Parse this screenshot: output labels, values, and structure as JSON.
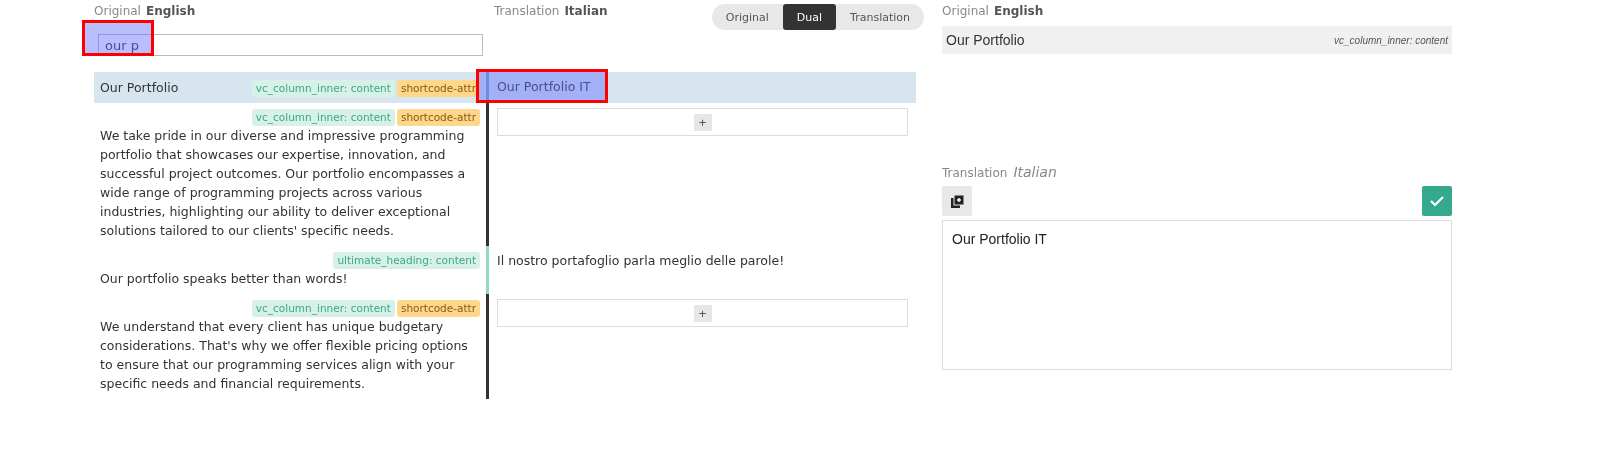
{
  "original_header": {
    "label": "Original",
    "language": "English"
  },
  "translation_header": {
    "label": "Translation",
    "language": "Italian"
  },
  "view_toggle": [
    {
      "label": "Original",
      "selected": false
    },
    {
      "label": "Dual",
      "selected": true
    },
    {
      "label": "Translation",
      "selected": false
    }
  ],
  "search": {
    "value": "our p",
    "highlighted": true
  },
  "rows": [
    {
      "text": "Our Portfolio",
      "tags": [
        {
          "label": "vc_column_inner: content",
          "kind": "context"
        },
        {
          "label": "shortcode-attr",
          "kind": "attr"
        }
      ],
      "selected": true,
      "translation": "Our Portfolio IT",
      "highlighted": true
    },
    {
      "text": "We take pride in our diverse and impressive programming portfolio that showcases our expertise, innovation, and successful project outcomes. Our portfolio encompasses a wide range of programming projects across various industries, highlighting our ability to deliver exceptional solutions tailored to our clients' specific needs.",
      "tags": [
        {
          "label": "vc_column_inner: content",
          "kind": "context"
        },
        {
          "label": "shortcode-attr",
          "kind": "attr"
        }
      ],
      "kind": "untranslated",
      "selected": false,
      "add_button": "+"
    },
    {
      "text": "Our portfolio speaks better than words!",
      "tags": [
        {
          "label": "ultimate_heading: content",
          "kind": "context"
        }
      ],
      "kind": "translated",
      "selected": false,
      "translation": "Il nostro portafoglio parla meglio delle parole!"
    },
    {
      "text": "We understand that every client has unique budgetary considerations. That's why we offer flexible pricing options to ensure that our programming services align with your specific needs and financial requirements.",
      "tags": [
        {
          "label": "vc_column_inner: content",
          "kind": "context"
        },
        {
          "label": "shortcode-attr",
          "kind": "attr"
        }
      ],
      "kind": "untranslated",
      "selected": false,
      "add_button": "+"
    }
  ],
  "editor": {
    "original_header": {
      "label": "Original",
      "language": "English"
    },
    "original_text": "Our Portfolio",
    "context": "vc_column_inner: content",
    "translation_header": {
      "label": "Translation",
      "language": "Italian"
    },
    "translation_value": "Our Portfolio IT"
  }
}
